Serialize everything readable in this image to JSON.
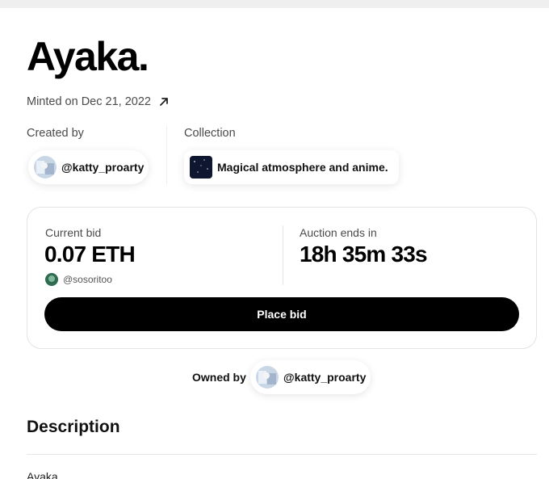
{
  "nft": {
    "title": "Ayaka.",
    "minted_text": "Minted on Dec 21, 2022"
  },
  "creator": {
    "label": "Created by",
    "handle": "@katty_proarty"
  },
  "collection": {
    "label": "Collection",
    "name": "Magical atmosphere and anime."
  },
  "auction": {
    "current_bid_label": "Current bid",
    "current_bid_value": "0.07 ETH",
    "bidder_handle": "@sosoritoo",
    "ends_label": "Auction ends in",
    "ends_value": "18h 35m 33s",
    "place_bid_label": "Place bid"
  },
  "owner": {
    "label": "Owned by",
    "handle": "@katty_proarty"
  },
  "description": {
    "heading": "Description",
    "text": "Ayaka"
  },
  "colors": {
    "accent": "#000000",
    "page_background": "#ffffff",
    "muted_text": "#4a4a4a"
  },
  "icons": {
    "minted_link": "arrow-up-right-icon"
  }
}
